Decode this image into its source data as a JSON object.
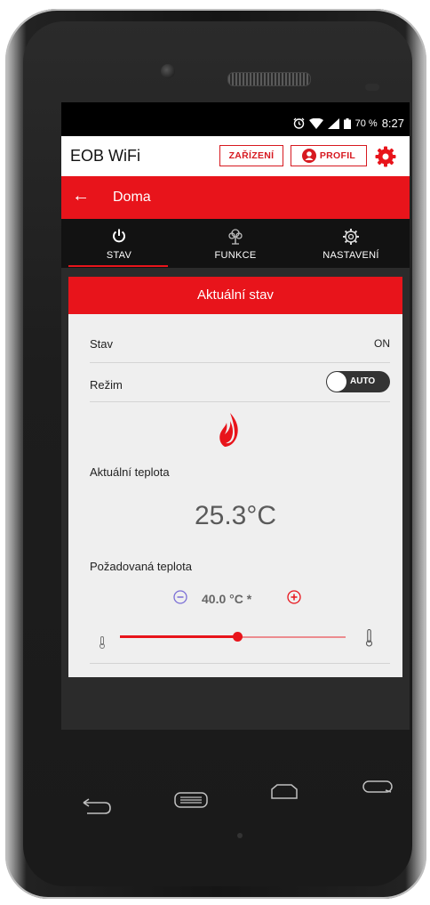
{
  "status_bar": {
    "battery": "70 %",
    "time": "8:27"
  },
  "app_bar": {
    "title": "EOB WiFi",
    "devices_button": "ZAŘÍZENÍ",
    "profile_button": "PROFIL"
  },
  "toolbar": {
    "title": "Doma"
  },
  "tabs": [
    {
      "label": "STAV",
      "icon": "power-icon",
      "active": true
    },
    {
      "label": "FUNKCE",
      "icon": "tree-icon",
      "active": false
    },
    {
      "label": "NASTAVENÍ",
      "icon": "gear-icon",
      "active": false
    }
  ],
  "card": {
    "header": "Aktuální stav",
    "status_label": "Stav",
    "status_value": "ON",
    "mode_label": "Režim",
    "mode_value": "AUTO",
    "current_temp_label": "Aktuální teplota",
    "current_temp": "25.3°C",
    "target_temp_label": "Požadovaná teplota",
    "target_temp": "40.0 °C *",
    "slider_fraction": 0.52
  },
  "colors": {
    "accent": "#e8141b",
    "toolbar_dark": "#121212",
    "card_bg": "#efefef"
  }
}
